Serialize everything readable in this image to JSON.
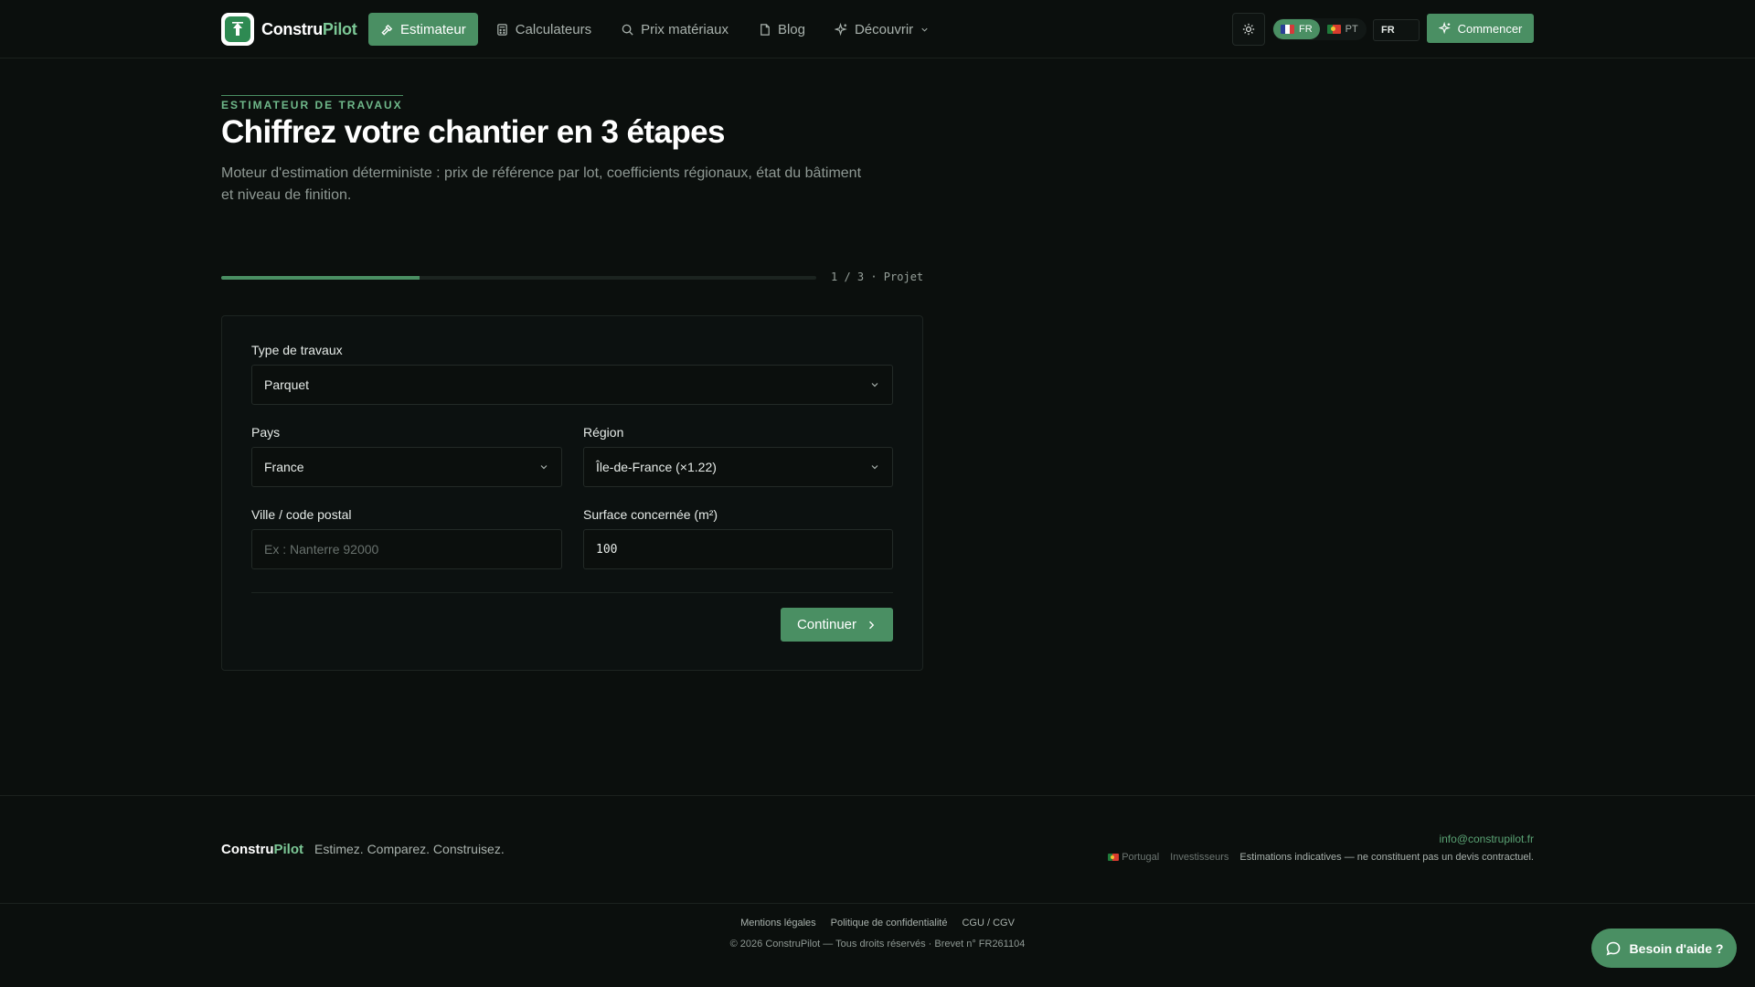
{
  "header": {
    "logo_a": "Constru",
    "logo_b": "Pilot",
    "nav": [
      {
        "label": "Estimateur"
      },
      {
        "label": "Calculateurs"
      },
      {
        "label": "Prix matériaux"
      },
      {
        "label": "Blog"
      },
      {
        "label": "Découvrir"
      }
    ],
    "lang_fr": "FR",
    "lang_pt": "PT",
    "lang_select": "FR",
    "cta": "Commencer"
  },
  "hero": {
    "eyebrow": "ESTIMATEUR DE TRAVAUX",
    "title": "Chiffrez votre chantier en 3 étapes",
    "subtitle": "Moteur d'estimation déterministe : prix de référence par lot, coefficients régionaux, état du bâtiment et niveau de finition."
  },
  "progress": {
    "current": 1,
    "total": 3,
    "fraction": 0.3333,
    "label": "1 / 3 · Projet"
  },
  "form": {
    "type_label": "Type de travaux",
    "type_value": "Parquet",
    "country_label": "Pays",
    "country_value": "France",
    "region_label": "Région",
    "region_value": "Île-de-France (×1.22)",
    "city_label": "Ville / code postal",
    "city_placeholder": "Ex : Nanterre 92000",
    "surface_label": "Surface concernée (m²)",
    "surface_value": "100",
    "continue": "Continuer"
  },
  "footer": {
    "brand_a": "Constru",
    "brand_b": "Pilot",
    "tagline": "Estimez. Comparez. Construisez.",
    "email": "info@construpilot.fr",
    "portugal": "Portugal",
    "investors": "Investisseurs",
    "note": "Estimations indicatives — ne constituent pas un devis contractuel.",
    "legal_links": [
      "Mentions légales",
      "Politique de confidentialité",
      "CGU / CGV"
    ],
    "copyright": "© 2026 ConstruPilot — Tous droits réservés · Brevet n° FR261104"
  },
  "help": {
    "label": "Besoin d'aide ?"
  },
  "colors": {
    "accent": "#4a8f63",
    "background": "#0b0f0d",
    "brand_green": "#7cc896"
  }
}
